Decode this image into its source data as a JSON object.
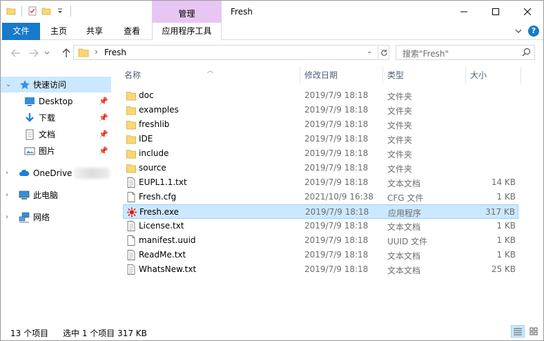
{
  "window": {
    "title": "Fresh",
    "context_tab_group": "管理"
  },
  "ribbon": {
    "tabs": [
      "文件",
      "主页",
      "共享",
      "查看",
      "应用程序工具"
    ]
  },
  "address": {
    "path": "Fresh",
    "search_placeholder": "搜索\"Fresh\""
  },
  "nav": {
    "quick_access": "快速访问",
    "items": [
      "Desktop",
      "下载",
      "文档",
      "图片"
    ],
    "onedrive": "OneDrive",
    "this_pc": "此电脑",
    "network": "网络"
  },
  "columns": {
    "name": "名称",
    "date": "修改日期",
    "type": "类型",
    "size": "大小"
  },
  "files": [
    {
      "name": "doc",
      "date": "2019/7/9 18:18",
      "type": "文件夹",
      "size": "",
      "icon": "folder"
    },
    {
      "name": "examples",
      "date": "2019/7/9 18:18",
      "type": "文件夹",
      "size": "",
      "icon": "folder"
    },
    {
      "name": "freshlib",
      "date": "2019/7/9 18:18",
      "type": "文件夹",
      "size": "",
      "icon": "folder"
    },
    {
      "name": "IDE",
      "date": "2019/7/9 18:18",
      "type": "文件夹",
      "size": "",
      "icon": "folder"
    },
    {
      "name": "include",
      "date": "2019/7/9 18:18",
      "type": "文件夹",
      "size": "",
      "icon": "folder"
    },
    {
      "name": "source",
      "date": "2019/7/9 18:18",
      "type": "文件夹",
      "size": "",
      "icon": "folder"
    },
    {
      "name": "EUPL1.1.txt",
      "date": "2019/7/9 18:18",
      "type": "文本文档",
      "size": "14 KB",
      "icon": "text"
    },
    {
      "name": "Fresh.cfg",
      "date": "2021/10/9 16:38",
      "type": "CFG 文件",
      "size": "1 KB",
      "icon": "blank"
    },
    {
      "name": "Fresh.exe",
      "date": "2019/7/9 18:18",
      "type": "应用程序",
      "size": "317 KB",
      "icon": "exe"
    },
    {
      "name": "License.txt",
      "date": "2019/7/9 18:18",
      "type": "文本文档",
      "size": "1 KB",
      "icon": "text"
    },
    {
      "name": "manifest.uuid",
      "date": "2019/7/9 18:18",
      "type": "UUID 文件",
      "size": "1 KB",
      "icon": "blank"
    },
    {
      "name": "ReadMe.txt",
      "date": "2019/7/9 18:18",
      "type": "文本文档",
      "size": "1 KB",
      "icon": "text"
    },
    {
      "name": "WhatsNew.txt",
      "date": "2019/7/9 18:18",
      "type": "文本文档",
      "size": "25 KB",
      "icon": "text"
    }
  ],
  "status": {
    "count": "13 个项目",
    "selection": "选中 1 个项目  317 KB"
  },
  "colors": {
    "accent": "#1979ca",
    "context_tab": "#e8c6f3",
    "selection": "#cce8ff",
    "folder": "#f8d775"
  }
}
